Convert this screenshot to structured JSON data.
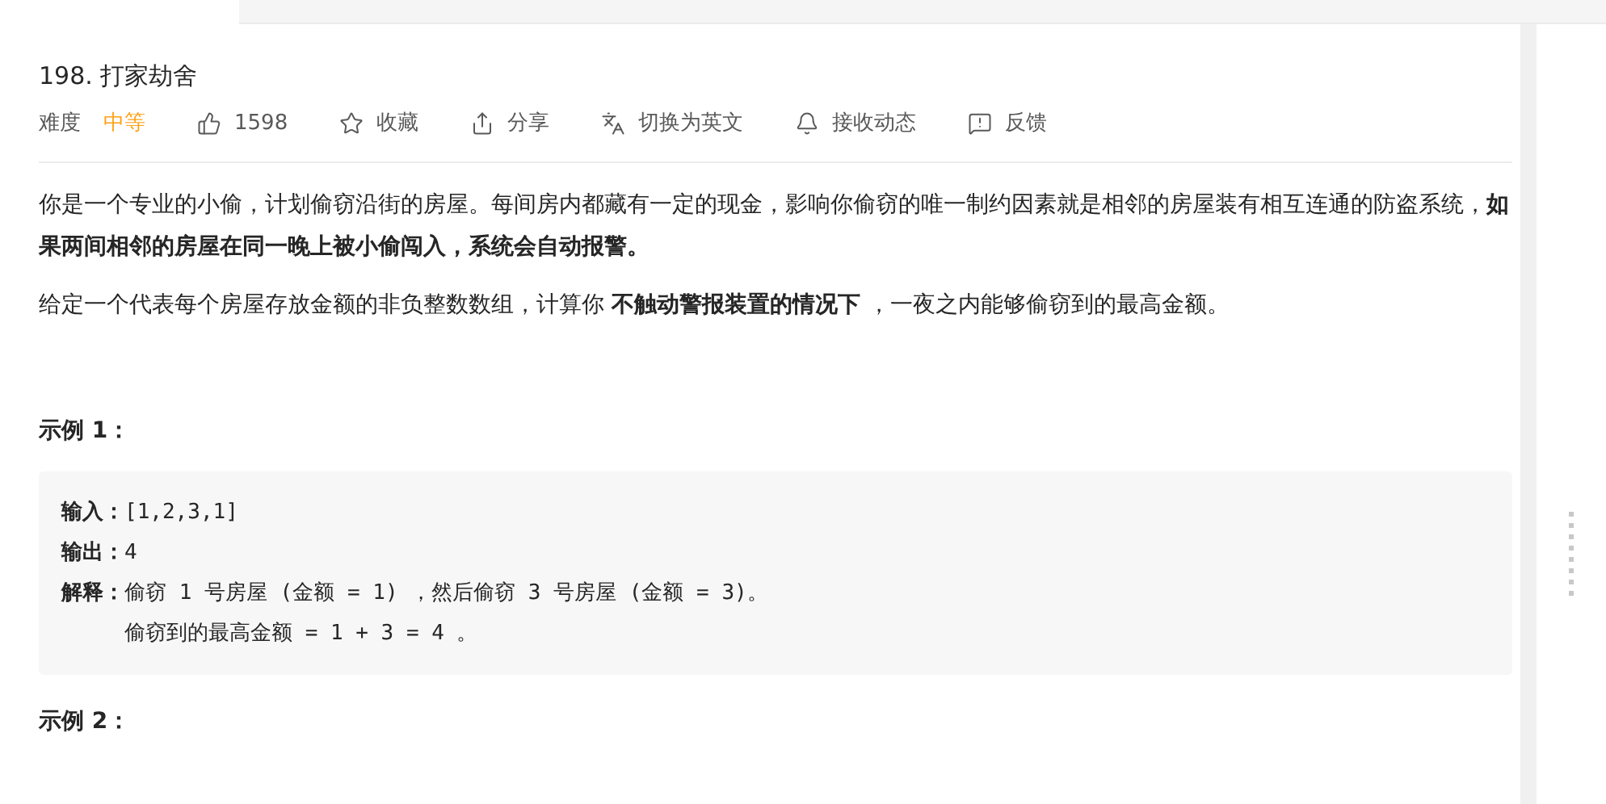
{
  "problem": {
    "title": "198. 打家劫舍",
    "difficulty": {
      "label": "难度",
      "value": "中等"
    },
    "actions": [
      {
        "kind": "like",
        "label": "1598"
      },
      {
        "kind": "favorite",
        "label": "收藏"
      },
      {
        "kind": "share",
        "label": "分享"
      },
      {
        "kind": "translate",
        "label": "切换为英文"
      },
      {
        "kind": "subscribe",
        "label": "接收动态"
      },
      {
        "kind": "feedback",
        "label": "反馈"
      }
    ],
    "description": [
      "你是一个专业的小偷，计划偷窃沿街的房屋。每间房内都藏有一定的现金，影响你偷窃的唯一制约因素就是相邻的房屋装有相互连通的防盗系统，**如果两间相邻的房屋在同一晚上被小偷闯入，系统会自动报警。**",
      "给定一个代表每个房屋存放金额的非负整数数组，计算你 **不触动警报装置的情况下** ，一夜之内能够偷窃到的最高金额。"
    ],
    "examples": [
      {
        "heading": "示例 1：",
        "lines": [
          {
            "label": "输入：",
            "values": [
              "[1,2,3,1]"
            ]
          },
          {
            "label": "输出：",
            "values": [
              "4"
            ]
          },
          {
            "label": "解释：",
            "values": [
              "偷窃 1 号房屋 (金额 = 1) ，然后偷窃 3 号房屋 (金额 = 3)。",
              "偷窃到的最高金额 = 1 + 3 = 4 。"
            ]
          }
        ]
      },
      {
        "heading": "示例 2："
      }
    ]
  }
}
